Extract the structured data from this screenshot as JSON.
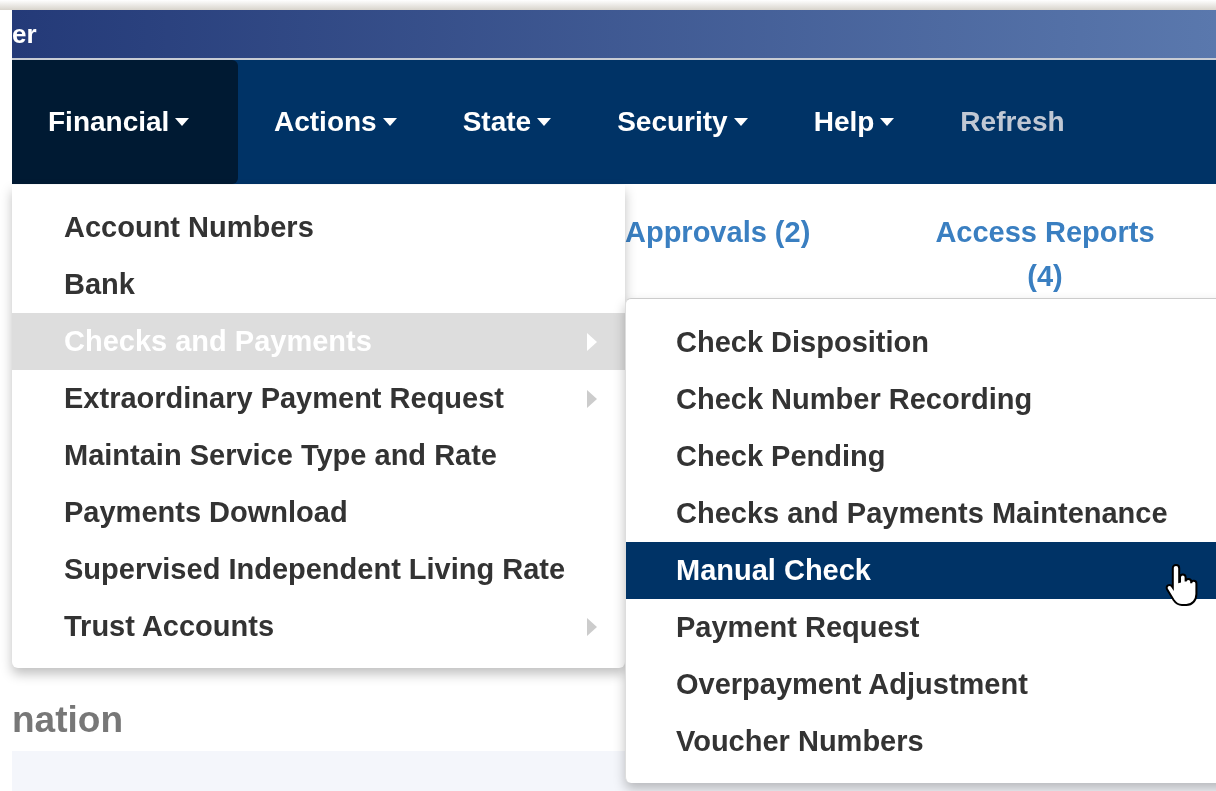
{
  "window": {
    "title": "er"
  },
  "nav": [
    {
      "label": "Financial",
      "selected": true,
      "dropdown": true,
      "disabled": false
    },
    {
      "label": "Actions",
      "selected": false,
      "dropdown": true,
      "disabled": false
    },
    {
      "label": "State",
      "selected": false,
      "dropdown": true,
      "disabled": false
    },
    {
      "label": "Security",
      "selected": false,
      "dropdown": true,
      "disabled": false
    },
    {
      "label": "Help",
      "selected": false,
      "dropdown": true,
      "disabled": false
    },
    {
      "label": "Refresh",
      "selected": false,
      "dropdown": false,
      "disabled": true
    }
  ],
  "links": [
    {
      "label": "Approvals (2)"
    },
    {
      "label": "Access Reports (4)"
    }
  ],
  "heading": "nation",
  "menu": [
    {
      "label": "Account Numbers",
      "selected": false,
      "submenu": false
    },
    {
      "label": "Bank",
      "selected": false,
      "submenu": false
    },
    {
      "label": "Checks and Payments",
      "selected": true,
      "submenu": true
    },
    {
      "label": "Extraordinary Payment Request",
      "selected": false,
      "submenu": true
    },
    {
      "label": "Maintain Service Type and Rate",
      "selected": false,
      "submenu": false
    },
    {
      "label": "Payments Download",
      "selected": false,
      "submenu": false
    },
    {
      "label": "Supervised Independent Living Rate",
      "selected": false,
      "submenu": false
    },
    {
      "label": "Trust Accounts",
      "selected": false,
      "submenu": true
    }
  ],
  "submenu": [
    {
      "label": "Check Disposition",
      "selected": false
    },
    {
      "label": "Check Number Recording",
      "selected": false
    },
    {
      "label": "Check Pending",
      "selected": false
    },
    {
      "label": "Checks and Payments Maintenance",
      "selected": false
    },
    {
      "label": "Manual Check",
      "selected": true
    },
    {
      "label": "Payment Request",
      "selected": false
    },
    {
      "label": "Overpayment Adjustment",
      "selected": false
    },
    {
      "label": "Voucher Numbers",
      "selected": false
    }
  ]
}
